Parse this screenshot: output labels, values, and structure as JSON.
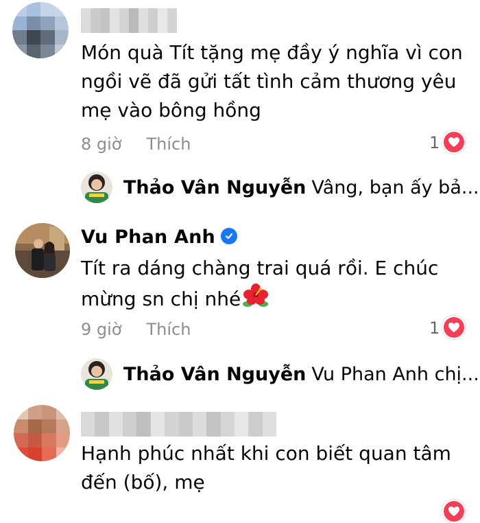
{
  "comments": [
    {
      "author": "",
      "text_lines": [
        "Món quà Tít tặng mẹ đầy ý nghĩa vì con",
        "ngồi vẽ đã gửi tất tình cảm thương yêu",
        "mẹ vào bông hồng"
      ],
      "time": "8 giờ",
      "like_label": "Thích",
      "reaction_count": "1",
      "reply": {
        "author": "Thảo Vân Nguyễn",
        "text": "Vâng, bạn ấy bả..."
      }
    },
    {
      "author": "Vu Phan Anh",
      "verified": true,
      "text_lines": [
        "Tít ra dáng chàng trai quá rồi. E chúc",
        "mừng sn chị nhé"
      ],
      "time": "9 giờ",
      "like_label": "Thích",
      "reaction_count": "1",
      "reply": {
        "author": "Thảo Vân Nguyễn",
        "text": "Vu Phan Anh chị..."
      }
    },
    {
      "author": "",
      "text_lines": [
        "Hạnh phúc nhất khi con biết quan tâm",
        "đến (bố), mẹ"
      ]
    }
  ],
  "icons": {
    "reaction": "heart-icon",
    "verified": "verified-badge-icon",
    "emoji": "hibiscus-emoji-icon"
  },
  "colors": {
    "heart": "#f33e58",
    "verified": "#1877f2",
    "meta": "#8a8d91"
  }
}
